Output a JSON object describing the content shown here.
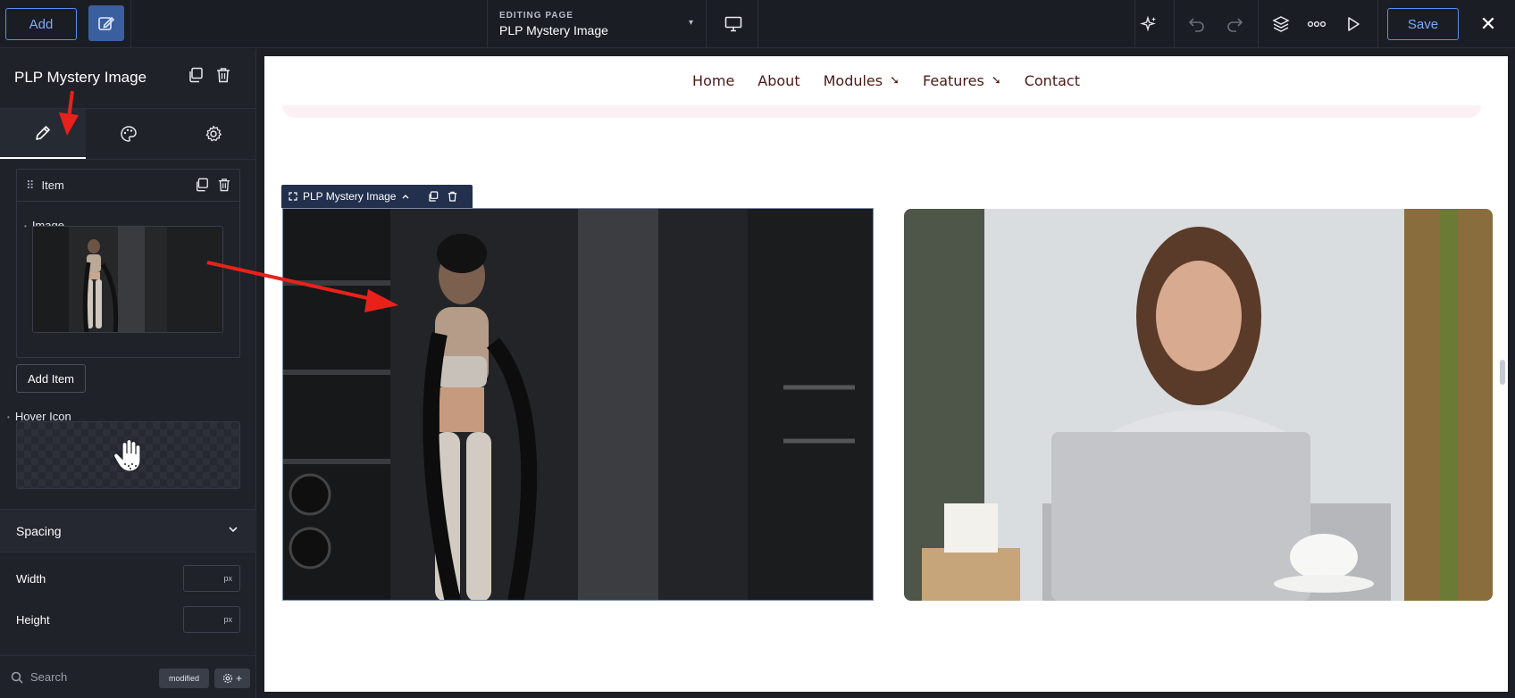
{
  "toolbar": {
    "add_label": "Add",
    "editing_label": "EDITING PAGE",
    "editing_value": "PLP Mystery Image",
    "save_label": "Save"
  },
  "panel": {
    "title": "PLP Mystery Image",
    "item_label": "Item",
    "image_label": "Image",
    "add_item_label": "Add Item",
    "hover_icon_label": "Hover Icon",
    "spacing_label": "Spacing",
    "width_label": "Width",
    "height_label": "Height",
    "unit": "px",
    "search_placeholder": "Search",
    "modified_badge": "modified"
  },
  "canvas": {
    "nav": [
      {
        "label": "Home",
        "has_arrow": false
      },
      {
        "label": "About",
        "has_arrow": false
      },
      {
        "label": "Modules",
        "has_arrow": true
      },
      {
        "label": "Features",
        "has_arrow": true
      },
      {
        "label": "Contact",
        "has_arrow": false
      }
    ],
    "nav_arrow_glyph": "➘",
    "selection_tag": "PLP Mystery Image"
  },
  "colors": {
    "accent": "#5b8df0",
    "nav_text": "#4a1a14",
    "annotation": "#e8221b"
  }
}
